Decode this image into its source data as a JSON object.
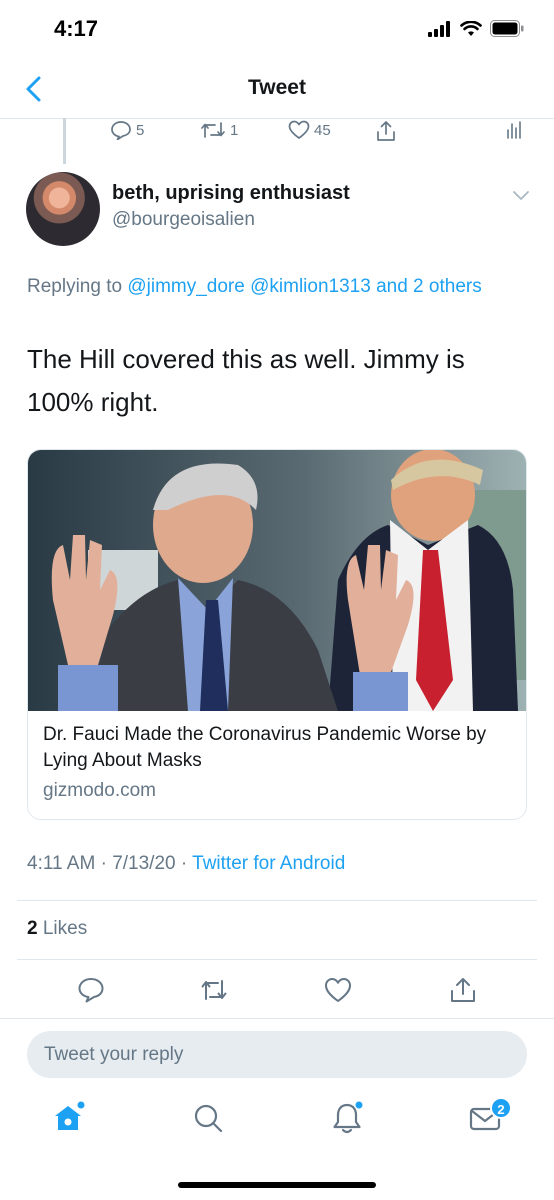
{
  "status_bar": {
    "time": "4:17"
  },
  "nav": {
    "title": "Tweet"
  },
  "parent_actions": {
    "replies": "5",
    "retweets": "1",
    "likes": "45"
  },
  "author": {
    "name": "beth, uprising enthusiast",
    "handle": "@bourgeoisalien"
  },
  "reply_context": {
    "prefix": "Replying to",
    "mention1": "@jimmy_dore",
    "mention2": "@kimlion1313",
    "others": "and 2 others"
  },
  "tweet": {
    "text": "The Hill covered this as well. Jimmy is 100% right."
  },
  "card": {
    "title": "Dr. Fauci Made the Coronavirus Pandemic Worse by Lying About Masks",
    "domain": "gizmodo.com"
  },
  "meta": {
    "time": "4:11 AM",
    "date": "7/13/20",
    "source": "Twitter for Android"
  },
  "stats": {
    "likes_count": "2",
    "likes_label": "Likes"
  },
  "reply_box": {
    "placeholder": "Tweet your reply"
  },
  "tab_bar": {
    "messages_badge": "2"
  },
  "colors": {
    "accent": "#1da1f2",
    "secondary_text": "#657786",
    "divider": "#e1e8ed"
  }
}
